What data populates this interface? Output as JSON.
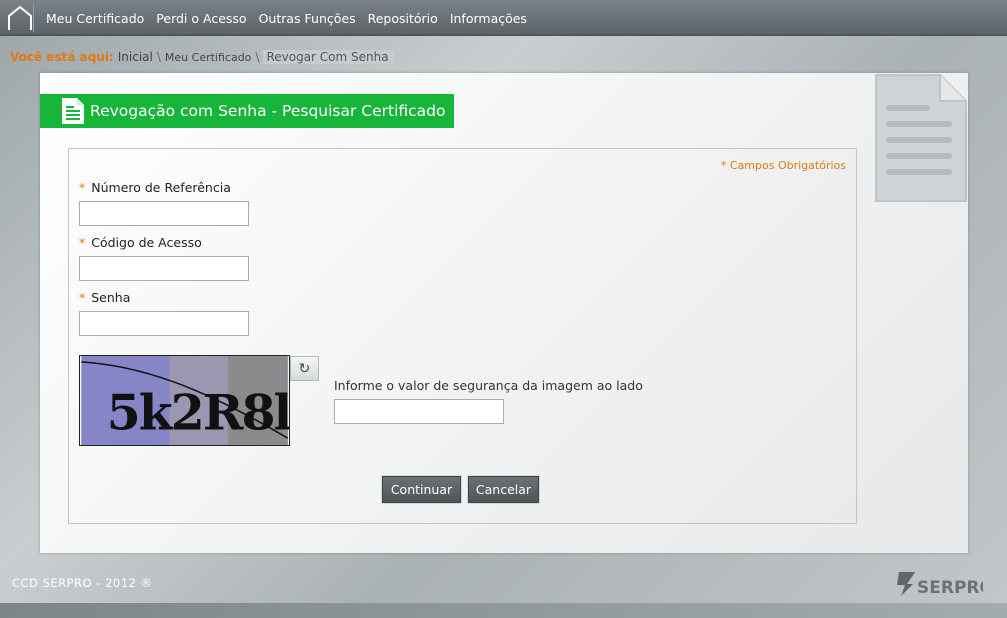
{
  "nav": {
    "home_icon": "home-icon",
    "items": [
      "Meu Certificado",
      "Perdi o Acesso",
      "Outras Funções",
      "Repositório",
      "Informações"
    ]
  },
  "breadcrumb": {
    "label": "Você está aqui:",
    "items": [
      "Inicial",
      "Meu Certificado",
      "Revogar Com Senha"
    ],
    "separator": "\\"
  },
  "page": {
    "title": "Revogação com Senha - Pesquisar Certificado",
    "title_icon": "document-icon",
    "required_note": "* Campos Obrigatórios"
  },
  "form": {
    "required_marker": "*",
    "fields": [
      {
        "label": "Número de Referência",
        "value": ""
      },
      {
        "label": "Código de Acesso",
        "value": ""
      },
      {
        "label": "Senha",
        "value": ""
      }
    ],
    "captcha": {
      "text": "5k2R8l",
      "refresh_icon": "refresh-icon",
      "label": "Informe o valor de segurança da imagem ao lado",
      "value": ""
    },
    "buttons": {
      "continue": "Continuar",
      "cancel": "Cancelar"
    }
  },
  "footer": {
    "text": "CCD SERPRO - 2012 ®",
    "logo_text": "SERPRO"
  },
  "colors": {
    "accent_orange": "#e07a10",
    "title_green": "#17b53a",
    "button_gray": "#5a6063"
  }
}
